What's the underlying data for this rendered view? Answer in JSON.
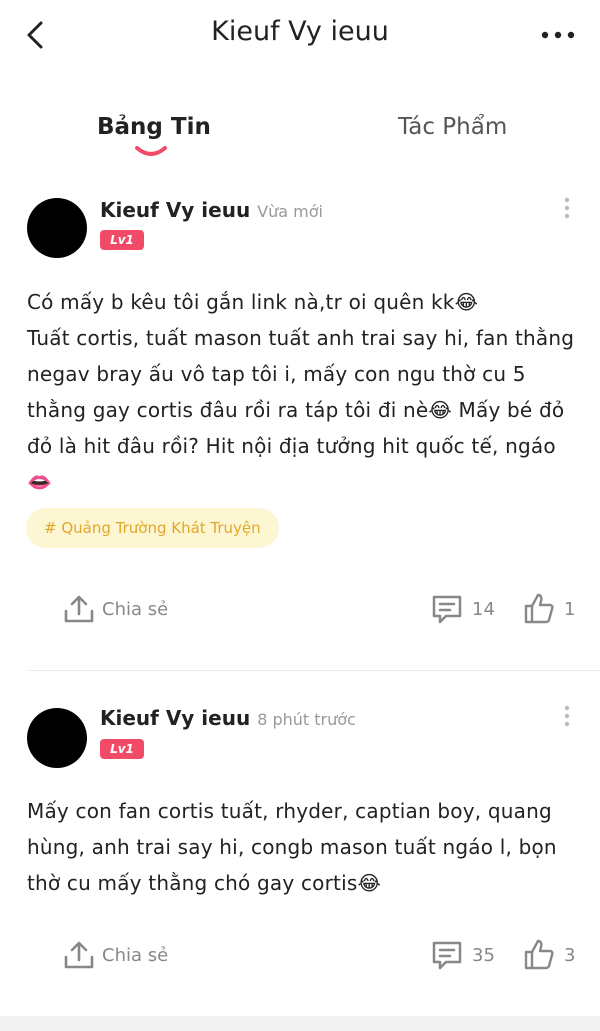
{
  "header": {
    "title": "Kieuf Vy ieuu"
  },
  "tabs": [
    {
      "label": "Bảng Tin"
    },
    {
      "label": "Tác Phẩm"
    }
  ],
  "posts": [
    {
      "username": "Kieuf Vy ieuu",
      "time": "Vừa mới",
      "level": "Lv1",
      "lines": [
        "Có mấy b kêu tôi gắn link nà,tr oi quên kk😂",
        "Tuất cortis, tuất mason tuất anh trai say hi, fan thằng",
        "negav bray ấu vô tap tôi i, mấy con ngu thờ cu 5",
        "thằng gay cortis đâu rồi ra táp tôi đi nè😂 Mấy bé đỏ",
        "đỏ là hit đâu rồi? Hit nội địa tưởng hit quốc tế, ngáo",
        "👄"
      ],
      "tag": "# Quảng Trường Khát Truyện",
      "share_label": "Chia sẻ",
      "comments": "14",
      "likes": "1"
    },
    {
      "username": "Kieuf Vy ieuu",
      "time": "8 phút trước",
      "level": "Lv1",
      "lines": [
        "Mấy con fan cortis tuất, rhyder, captian boy, quang",
        "hùng, anh trai say hi, congb mason tuất ngáo l, bọn",
        "thờ cu mấy thằng chó gay cortis😂"
      ],
      "share_label": "Chia sẻ",
      "comments": "35",
      "likes": "3"
    }
  ]
}
